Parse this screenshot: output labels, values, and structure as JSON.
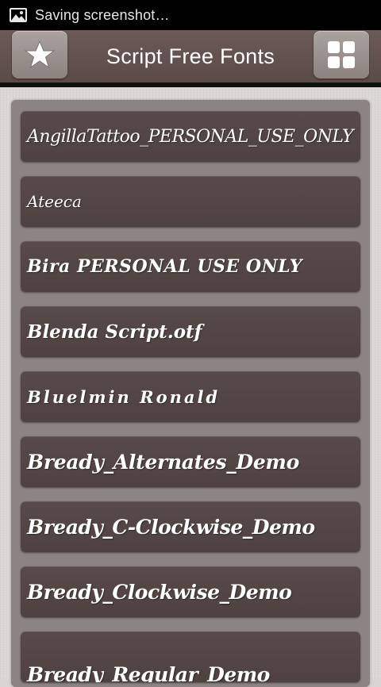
{
  "status_bar": {
    "notification_icon": "image-icon",
    "text": "Saving screenshot…"
  },
  "action_bar": {
    "title": "Script Free Fonts",
    "left_button_icon": "star-icon",
    "right_button_icon": "grid-icon"
  },
  "fonts": [
    {
      "name": "AngillaTattoo_PERSONAL_USE_ONLY"
    },
    {
      "name": "Ateeca"
    },
    {
      "name": "Bira PERSONAL USE ONLY"
    },
    {
      "name": "Blenda Script.otf"
    },
    {
      "name": "Bluelmin Ronald"
    },
    {
      "name": "Bready_Alternates_Demo"
    },
    {
      "name": "Bready_C-Clockwise_Demo"
    },
    {
      "name": "Bready_Clockwise_Demo"
    },
    {
      "name": "Bready_Regular_Demo"
    }
  ],
  "colors": {
    "action_bar": "#5f4f4d",
    "list_item": "#524544",
    "panel": "#8d8380",
    "background": "#dcd9d5"
  }
}
